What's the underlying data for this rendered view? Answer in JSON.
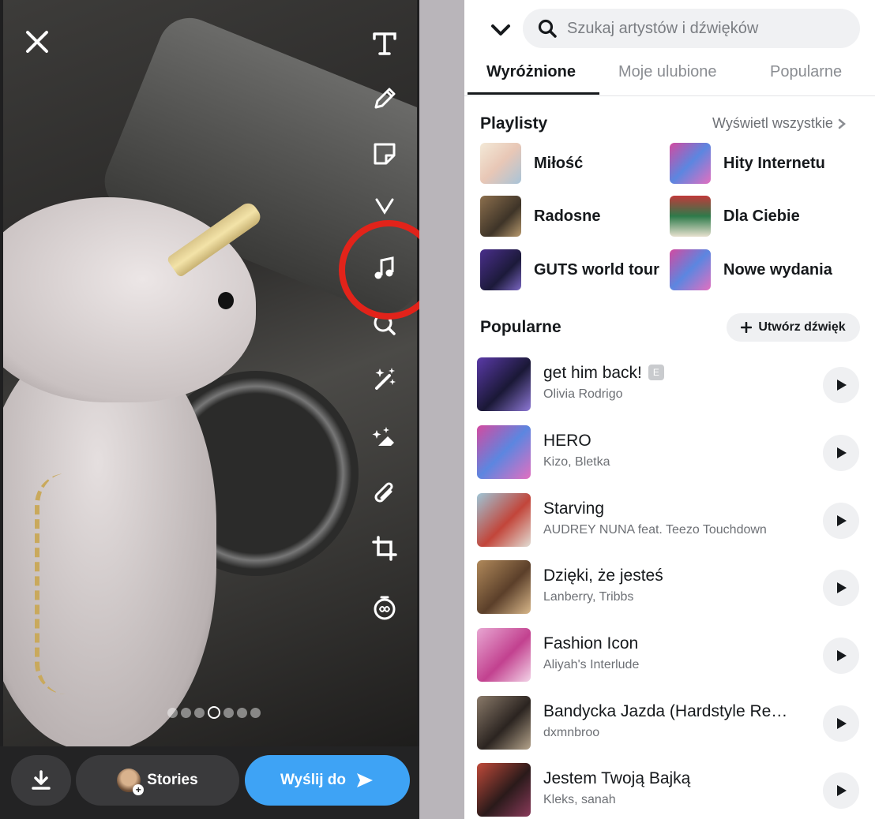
{
  "editor": {
    "close_icon": "close-icon",
    "tools": [
      "text-icon",
      "pen-icon",
      "sticker-icon",
      "scissors-icon",
      "music-icon",
      "lens-search-icon",
      "magic-wand-icon",
      "eraser-icon",
      "paperclip-icon",
      "crop-icon",
      "timer-icon"
    ],
    "highlight_color": "#e2231a",
    "page_dots": 6,
    "active_dot": 3
  },
  "bottom_bar": {
    "stories_label": "Stories",
    "send_label": "Wyślij do",
    "send_color": "#3ea3f5"
  },
  "sound_picker": {
    "search_placeholder": "Szukaj artystów i dźwięków",
    "tabs": [
      {
        "label": "Wyróżnione",
        "active": true
      },
      {
        "label": "Moje ulubione",
        "active": false
      },
      {
        "label": "Popularne",
        "active": false
      }
    ],
    "playlists_title": "Playlisty",
    "see_all_label": "Wyświetl wszystkie",
    "playlists": [
      {
        "label": "Miłość"
      },
      {
        "label": "Hity Internetu"
      },
      {
        "label": "Radosne"
      },
      {
        "label": "Dla Ciebie"
      },
      {
        "label": "GUTS world tour"
      },
      {
        "label": "Nowe wydania"
      }
    ],
    "popular_title": "Popularne",
    "create_label": "Utwórz dźwięk",
    "tracks": [
      {
        "title": "get him back!",
        "artist": "Olivia Rodrigo",
        "explicit": "E"
      },
      {
        "title": "HERO",
        "artist": "Kizo, Bletka"
      },
      {
        "title": "Starving",
        "artist": "AUDREY NUNA feat. Teezo Touchdown"
      },
      {
        "title": "Dzięki, że jesteś",
        "artist": "Lanberry, Tribbs"
      },
      {
        "title": "Fashion Icon",
        "artist": "Aliyah's Interlude"
      },
      {
        "title": "Bandycka Jazda (Hardstyle Re…",
        "artist": "dxmnbroo"
      },
      {
        "title": "Jestem Twoją Bajką",
        "artist": "Kleks, sanah"
      }
    ]
  }
}
